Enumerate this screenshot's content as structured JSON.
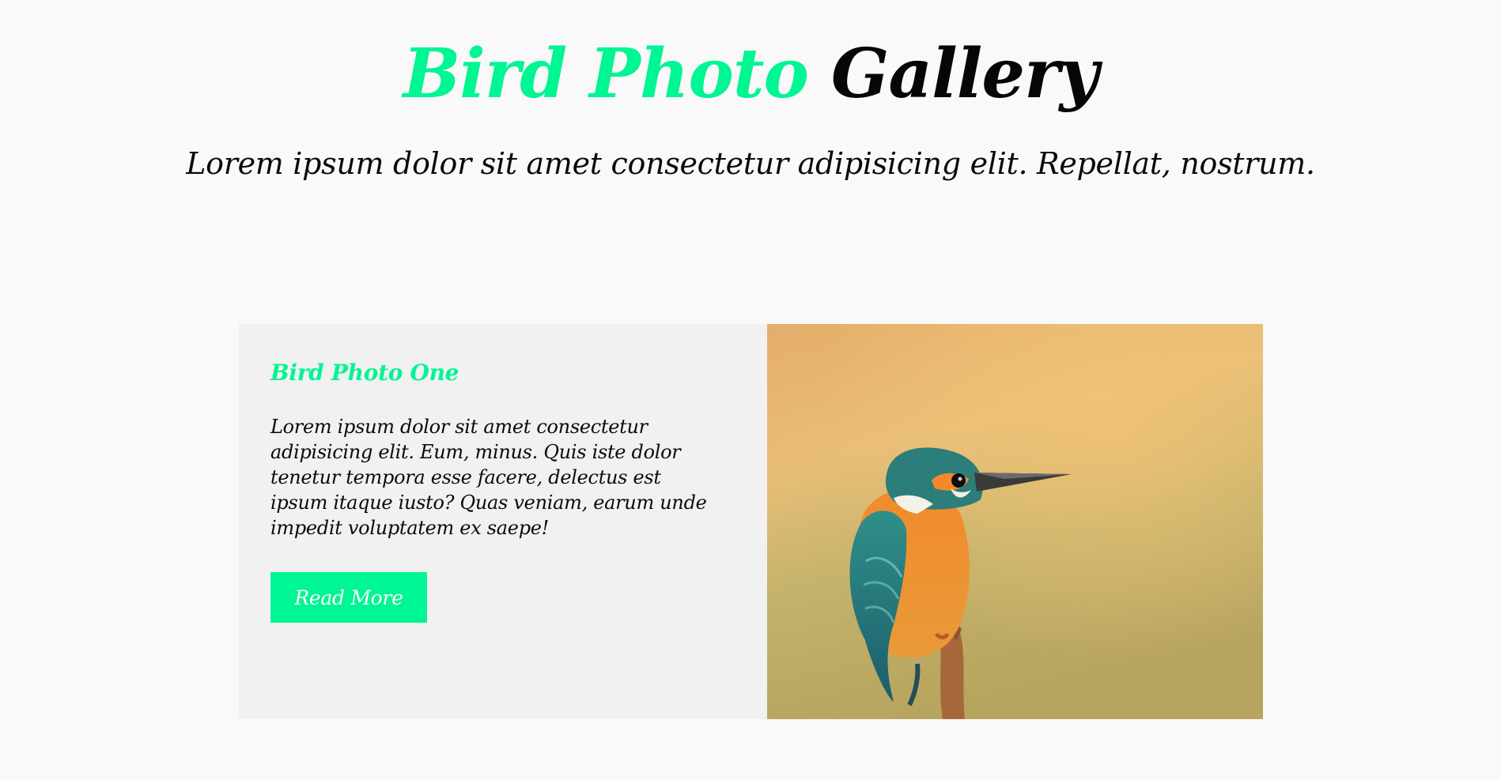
{
  "header": {
    "title_accent": "Bird Photo",
    "title_plain": "Gallery",
    "subtitle": "Lorem ipsum dolor sit amet consectetur adipisicing elit. Repellat, nostrum."
  },
  "card": {
    "title": "Bird Photo One",
    "body": "Lorem ipsum dolor sit amet consectetur adipisicing elit. Eum, minus. Quis iste dolor tenetur tempora esse facere, delectus est ipsum itaque iusto? Quas veniam, earum unde impedit voluptatem ex saepe!",
    "button_label": "Read More",
    "image_subject": "kingfisher-photo"
  },
  "colors": {
    "accent": "#00f593",
    "background": "#f9f9f9",
    "card_background": "#f1f1f1",
    "text": "#0a0a0a"
  }
}
